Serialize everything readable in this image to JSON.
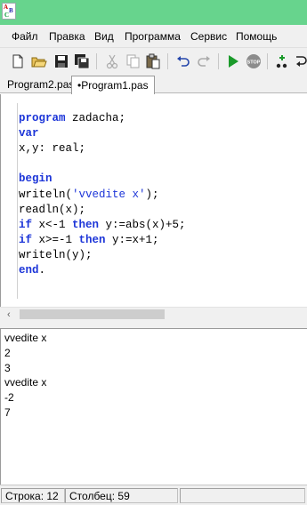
{
  "window": {
    "icon": "pascalabc-icon",
    "icon_letters": [
      "A",
      "B",
      "C"
    ]
  },
  "menu": {
    "items": [
      "Файл",
      "Правка",
      "Вид",
      "Программа",
      "Сервис",
      "Помощь"
    ]
  },
  "toolbar": {
    "buttons": [
      "new-file-icon",
      "open-folder-icon",
      "save-icon",
      "save-all-icon",
      "cut-icon",
      "copy-icon",
      "paste-icon",
      "undo-icon",
      "redo-icon",
      "run-icon",
      "stop-icon",
      "step-over-icon",
      "step-into-icon"
    ],
    "stop_label": "STOP"
  },
  "tabs": [
    {
      "label": "Program2.pas",
      "active": false
    },
    {
      "label": "•Program1.pas",
      "active": true
    }
  ],
  "editor": {
    "lines": [
      [
        {
          "t": "program",
          "c": "kw"
        },
        {
          "t": " zadacha;",
          "c": "plain"
        }
      ],
      [
        {
          "t": "var",
          "c": "kw"
        }
      ],
      [
        {
          "t": "x,y: real;",
          "c": "plain"
        }
      ],
      [],
      [
        {
          "t": "begin",
          "c": "kw"
        }
      ],
      [
        {
          "t": "writeln(",
          "c": "plain"
        },
        {
          "t": "'vvedite x'",
          "c": "str"
        },
        {
          "t": ");",
          "c": "plain"
        }
      ],
      [
        {
          "t": "readln(x);",
          "c": "plain"
        }
      ],
      [
        {
          "t": "if",
          "c": "kw"
        },
        {
          "t": " x<-1 ",
          "c": "plain"
        },
        {
          "t": "then",
          "c": "kw"
        },
        {
          "t": " y:=abs(x)+5;",
          "c": "plain"
        }
      ],
      [
        {
          "t": "if",
          "c": "kw"
        },
        {
          "t": " x>=-1 ",
          "c": "plain"
        },
        {
          "t": "then",
          "c": "kw"
        },
        {
          "t": " y:=x+1;",
          "c": "plain"
        }
      ],
      [
        {
          "t": "writeln(y);",
          "c": "plain"
        }
      ],
      [
        {
          "t": "end",
          "c": "kw"
        },
        {
          "t": ".",
          "c": "plain"
        }
      ]
    ],
    "colors": {
      "keyword": "#1c35d8",
      "string": "#1c35d8",
      "plain": "#000000"
    }
  },
  "output": {
    "lines": [
      "vvedite x",
      "2",
      "3",
      "vvedite x",
      "-2",
      "7"
    ]
  },
  "status": {
    "row": "Строка: 12",
    "col": "Столбец: 59"
  },
  "colors": {
    "titlebar": "#67d48d",
    "chrome": "#f0f0f0",
    "run_green": "#1a9a2a",
    "stop_gray": "#8c8c8c"
  }
}
